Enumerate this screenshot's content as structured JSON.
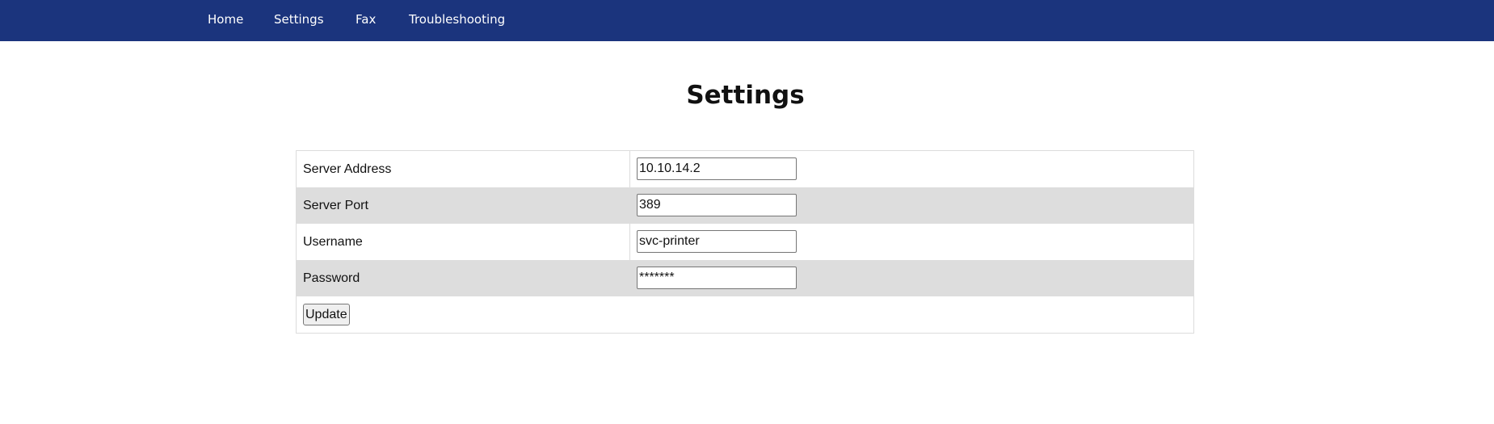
{
  "nav": {
    "items": [
      {
        "label": "Home"
      },
      {
        "label": "Settings"
      },
      {
        "label": "Fax"
      },
      {
        "label": "Troubleshooting"
      }
    ]
  },
  "page": {
    "title": "Settings"
  },
  "form": {
    "rows": [
      {
        "label": "Server Address",
        "value": "10.10.14.2"
      },
      {
        "label": "Server Port",
        "value": "389"
      },
      {
        "label": "Username",
        "value": "svc-printer"
      },
      {
        "label": "Password",
        "value": "*******"
      }
    ],
    "update_label": "Update"
  },
  "colors": {
    "navbar_bg": "#1b347d",
    "row_shaded_bg": "#dddddd"
  }
}
